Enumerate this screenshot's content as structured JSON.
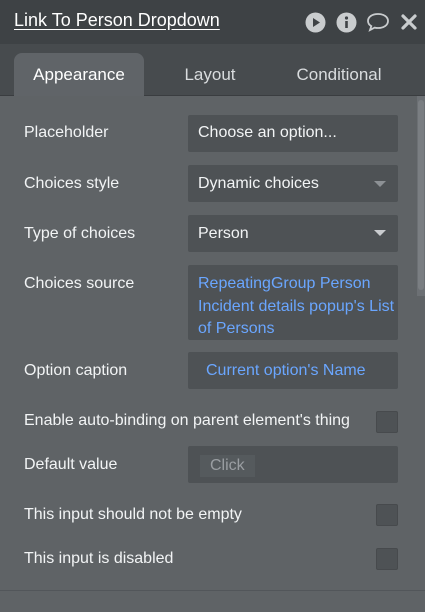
{
  "header": {
    "title": "Link To Person Dropdown",
    "icons": [
      "play-icon",
      "info-icon",
      "comment-icon",
      "close-icon"
    ]
  },
  "tabs": [
    {
      "label": "Appearance",
      "active": true
    },
    {
      "label": "Layout",
      "active": false
    },
    {
      "label": "Conditional",
      "active": false
    }
  ],
  "fields": {
    "placeholder": {
      "label": "Placeholder",
      "value": "Choose an option..."
    },
    "choices_style": {
      "label": "Choices style",
      "value": "Dynamic choices"
    },
    "type_of_choices": {
      "label": "Type of choices",
      "value": "Person"
    },
    "choices_source": {
      "label": "Choices source",
      "line1": "RepeatingGroup Person",
      "line2": "Incident details popup's List",
      "line3": "of Persons"
    },
    "option_caption": {
      "label": "Option caption",
      "value": "Current option's Name"
    },
    "auto_binding": {
      "label": "Enable auto-binding on parent element's thing",
      "checked": false
    },
    "default_value": {
      "label": "Default value",
      "placeholder": "Click"
    },
    "not_empty": {
      "label": "This input should not be empty",
      "checked": false
    },
    "disabled": {
      "label": "This input is disabled",
      "checked": false
    }
  },
  "colors": {
    "panel_bg": "#5f6366",
    "header_bg": "#3e4245",
    "field_bg": "#4e5255",
    "dynamic_text": "#6aa6ff"
  }
}
